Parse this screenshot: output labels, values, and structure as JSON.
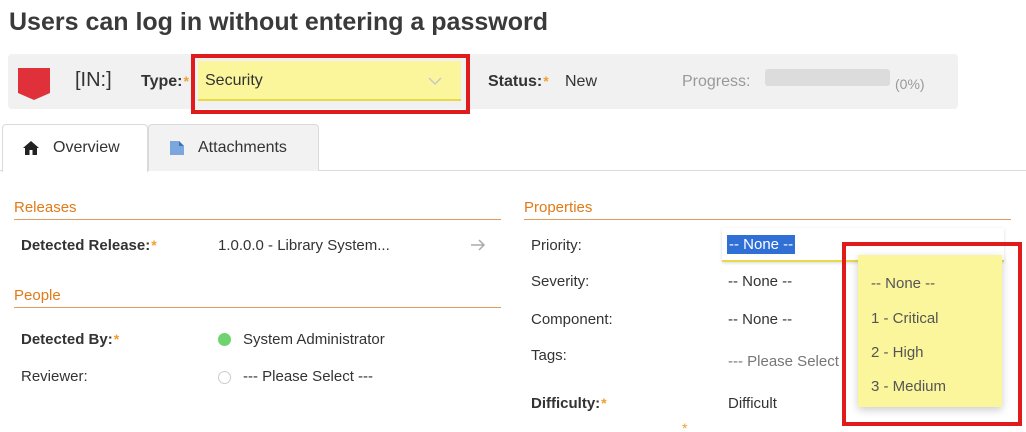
{
  "page": {
    "title": "Users can log in without entering a password"
  },
  "header": {
    "incident_id": "[IN:]",
    "type_label": "Type:",
    "type_value": "Security",
    "status_label": "Status:",
    "status_value": "New",
    "progress_label": "Progress:",
    "progress_fraction": 0,
    "progress_text": "(0%)",
    "required_mark": "*"
  },
  "tabs": [
    {
      "label": "Overview",
      "icon": "home-icon"
    },
    {
      "label": "Attachments",
      "icon": "document-icon"
    }
  ],
  "releases": {
    "heading": "Releases",
    "detected_release_label": "Detected Release:",
    "detected_release_value": "1.0.0.0 - Library System..."
  },
  "people": {
    "heading": "People",
    "detected_by_label": "Detected By:",
    "detected_by_value": "System Administrator",
    "reviewer_label": "Reviewer:",
    "reviewer_value": "--- Please Select ---"
  },
  "properties": {
    "heading": "Properties",
    "priority_label": "Priority:",
    "priority_value": "-- None --",
    "severity_label": "Severity:",
    "severity_value": "-- None --",
    "component_label": "Component:",
    "component_value": "-- None --",
    "tags_label": "Tags:",
    "tags_placeholder": "--- Please Select",
    "difficulty_label": "Difficulty:",
    "difficulty_value": "Difficult",
    "priority_options": [
      "-- None --",
      "1 - Critical",
      "2 - High",
      "3 - Medium"
    ]
  },
  "colors": {
    "accent_orange": "#e07b17",
    "highlight_yellow": "#fbf59c",
    "annotation_red": "#e01b1b",
    "flag_red": "#e0303a",
    "online_green": "#6fd36f"
  }
}
